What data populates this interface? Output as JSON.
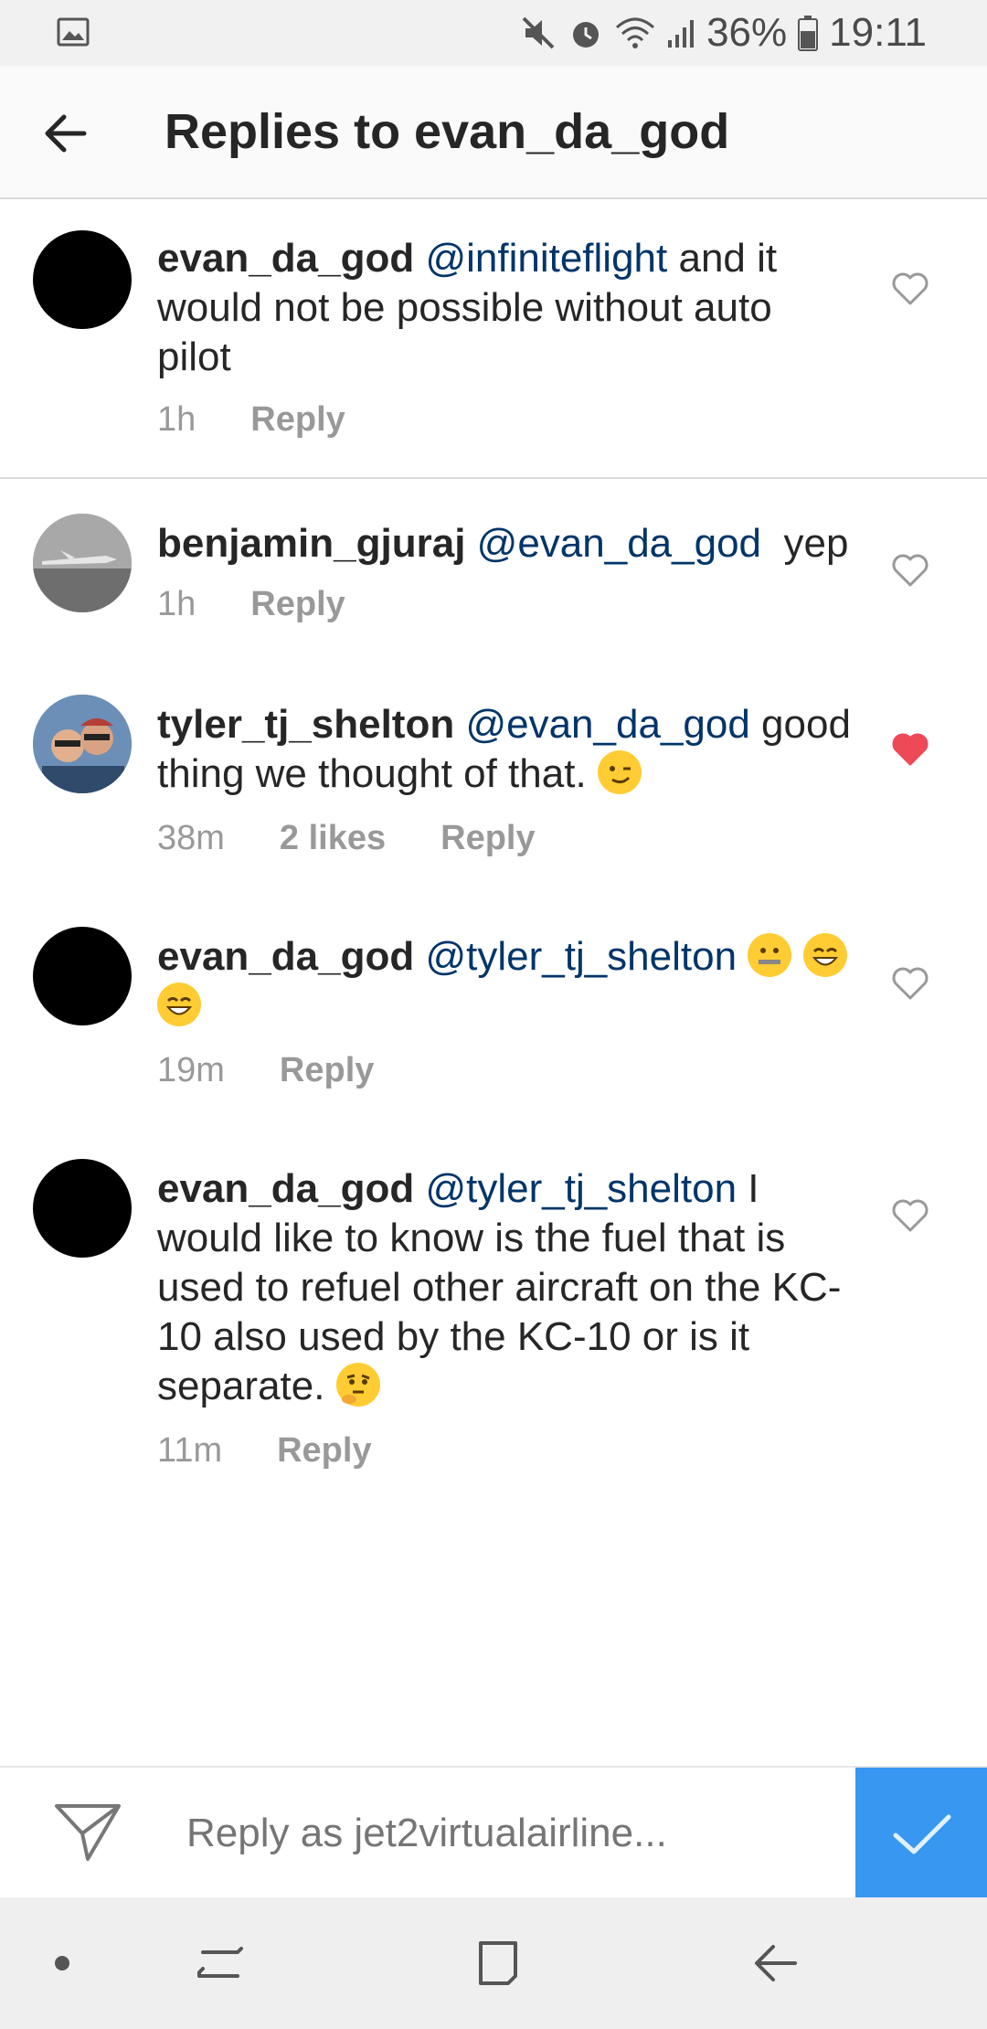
{
  "status_bar": {
    "battery": "36%",
    "time": "19:11",
    "icons": [
      "image-icon",
      "mute-icon",
      "alarm-icon",
      "wifi-icon",
      "signal-icon",
      "battery-icon"
    ]
  },
  "header": {
    "title": "Replies to evan_da_god"
  },
  "comments": [
    {
      "username": "evan_da_god",
      "mention": "@infiniteflight",
      "text": " and it would not be possible without auto pilot",
      "time": "1h",
      "likes": "",
      "reply_label": "Reply",
      "liked": false
    },
    {
      "username": "benjamin_gjuraj",
      "mention": "@evan_da_god",
      "text": "  yep",
      "time": "1h",
      "likes": "",
      "reply_label": "Reply",
      "liked": false
    },
    {
      "username": "tyler_tj_shelton",
      "mention": "@evan_da_god",
      "text": " good thing we thought of that.",
      "emojis": [
        "winking-face"
      ],
      "time": "38m",
      "likes": "2 likes",
      "reply_label": "Reply",
      "liked": true
    },
    {
      "username": "evan_da_god",
      "mention": "@tyler_tj_shelton",
      "text": "",
      "emojis": [
        "zipper-mouth-face",
        "grinning-face",
        "grinning-face"
      ],
      "time": "19m",
      "likes": "",
      "reply_label": "Reply",
      "liked": false
    },
    {
      "username": "evan_da_god",
      "mention": "@tyler_tj_shelton",
      "text": " I would like to know is the fuel that is used to refuel other aircraft on the KC-10 also used by the KC-10 or is it separate.",
      "emojis": [
        "thinking-face"
      ],
      "time": "11m",
      "likes": "",
      "reply_label": "Reply",
      "liked": false
    }
  ],
  "composer": {
    "placeholder": "Reply as jet2virtualairline..."
  },
  "colors": {
    "accent": "#3897f0",
    "mention": "#003569",
    "like_red": "#ed4956"
  }
}
